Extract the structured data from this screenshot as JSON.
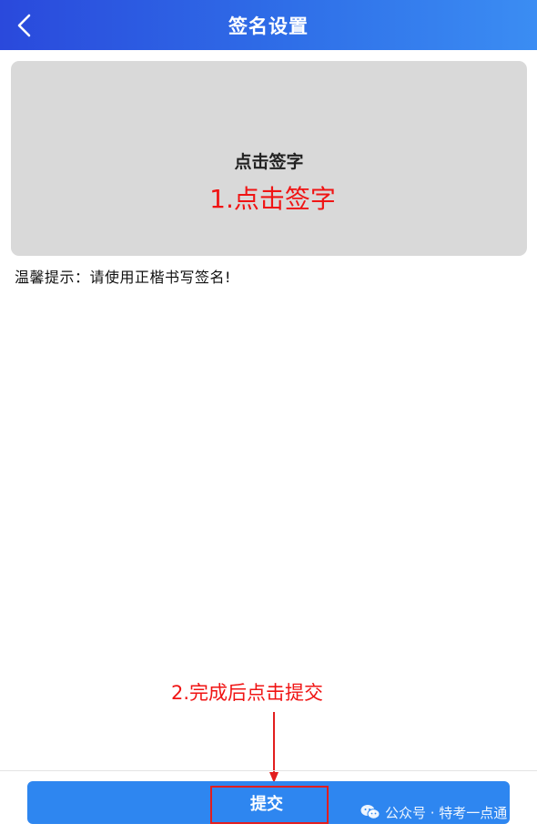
{
  "header": {
    "title": "签名设置",
    "back_icon": "chevron-left-icon"
  },
  "sign_pad": {
    "label": "点击签字"
  },
  "tip": {
    "text": "温馨提示：请使用正楷书写签名!"
  },
  "annotations": {
    "step1": "1.点击签字",
    "step2": "2.完成后点击提交"
  },
  "footer": {
    "submit_label": "提交"
  },
  "watermark": {
    "text": "公众号 · 特考一点通",
    "icon": "wechat-icon"
  },
  "colors": {
    "header_start": "#2a49dc",
    "header_end": "#3b8df3",
    "button": "#2e86f0",
    "annotation": "#f01414",
    "pad_bg": "#d9d9d9"
  }
}
